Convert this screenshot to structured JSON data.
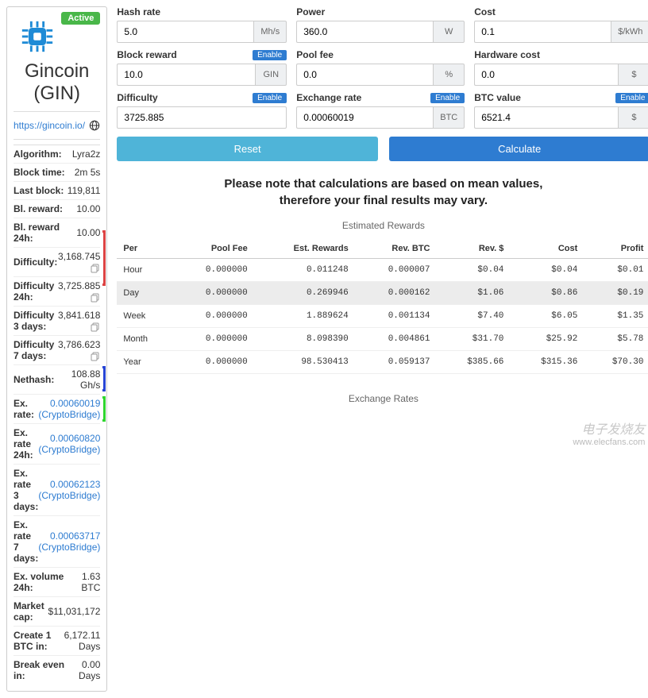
{
  "coin": {
    "status": "Active",
    "name": "Gincoin (GIN)",
    "url": "https://gincoin.io/"
  },
  "stats": {
    "algorithm": {
      "label": "Algorithm:",
      "value": "Lyra2z"
    },
    "block_time": {
      "label": "Block time:",
      "value": "2m 5s"
    },
    "last_block": {
      "label": "Last block:",
      "value": "119,811"
    },
    "bl_reward": {
      "label": "Bl. reward:",
      "value": "10.00"
    },
    "bl_reward_24h": {
      "label": "Bl. reward 24h:",
      "value": "10.00"
    },
    "difficulty": {
      "label": "Difficulty:",
      "value": "3,168.745"
    },
    "difficulty_24h": {
      "label": "Difficulty 24h:",
      "value": "3,725.885"
    },
    "difficulty_3d": {
      "label": "Difficulty 3 days:",
      "value": "3,841.618"
    },
    "difficulty_7d": {
      "label": "Difficulty 7 days:",
      "value": "3,786.623"
    },
    "nethash": {
      "label": "Nethash:",
      "value": "108.88 Gh/s"
    },
    "ex_rate": {
      "label": "Ex. rate:",
      "value": "0.00060019 (CryptoBridge)"
    },
    "ex_rate_24h": {
      "label": "Ex. rate 24h:",
      "value": "0.00060820 (CryptoBridge)"
    },
    "ex_rate_3d": {
      "label": "Ex. rate 3 days:",
      "value": "0.00062123 (CryptoBridge)"
    },
    "ex_rate_7d": {
      "label": "Ex. rate 7 days:",
      "value": "0.00063717 (CryptoBridge)"
    },
    "ex_vol_24h": {
      "label": "Ex. volume 24h:",
      "value": "1.63 BTC"
    },
    "market_cap": {
      "label": "Market cap:",
      "value": "$11,031,172"
    },
    "create_btc": {
      "label": "Create 1 BTC in:",
      "value": "6,172.11 Days"
    },
    "break_even": {
      "label": "Break even in:",
      "value": "0.00 Days"
    }
  },
  "form": {
    "hash_rate": {
      "label": "Hash rate",
      "value": "5.0",
      "unit": "Mh/s"
    },
    "power": {
      "label": "Power",
      "value": "360.0",
      "unit": "W"
    },
    "cost": {
      "label": "Cost",
      "value": "0.1",
      "unit": "$/kWh"
    },
    "block_reward": {
      "label": "Block reward",
      "value": "10.0",
      "unit": "GIN",
      "enable": "Enable"
    },
    "pool_fee": {
      "label": "Pool fee",
      "value": "0.0",
      "unit": "%"
    },
    "hardware_cost": {
      "label": "Hardware cost",
      "value": "0.0",
      "unit": "$"
    },
    "difficulty": {
      "label": "Difficulty",
      "value": "3725.885",
      "unit": "",
      "enable": "Enable"
    },
    "exchange_rate": {
      "label": "Exchange rate",
      "value": "0.00060019",
      "unit": "BTC",
      "enable": "Enable"
    },
    "btc_value": {
      "label": "BTC value",
      "value": "6521.4",
      "unit": "$",
      "enable": "Enable"
    }
  },
  "buttons": {
    "reset": "Reset",
    "calculate": "Calculate"
  },
  "note": "Please note that calculations are based on mean values,\ntherefore your final results may vary.",
  "rewards_title": "Estimated Rewards",
  "rewards_headers": [
    "Per",
    "Pool Fee",
    "Est. Rewards",
    "Rev. BTC",
    "Rev. $",
    "Cost",
    "Profit"
  ],
  "rewards": [
    {
      "per": "Hour",
      "pool_fee": "0.000000",
      "est": "0.011248",
      "rev_btc": "0.000007",
      "rev_usd": "$0.04",
      "cost": "$0.04",
      "profit": "$0.01"
    },
    {
      "per": "Day",
      "pool_fee": "0.000000",
      "est": "0.269946",
      "rev_btc": "0.000162",
      "rev_usd": "$1.06",
      "cost": "$0.86",
      "profit": "$0.19",
      "highlight": true
    },
    {
      "per": "Week",
      "pool_fee": "0.000000",
      "est": "1.889624",
      "rev_btc": "0.001134",
      "rev_usd": "$7.40",
      "cost": "$6.05",
      "profit": "$1.35"
    },
    {
      "per": "Month",
      "pool_fee": "0.000000",
      "est": "8.098390",
      "rev_btc": "0.004861",
      "rev_usd": "$31.70",
      "cost": "$25.92",
      "profit": "$5.78"
    },
    {
      "per": "Year",
      "pool_fee": "0.000000",
      "est": "98.530413",
      "rev_btc": "0.059137",
      "rev_usd": "$385.66",
      "cost": "$315.36",
      "profit": "$70.30"
    }
  ],
  "exchange_rates_title": "Exchange Rates",
  "watermark": {
    "sign": "电子发烧友",
    "url": "www.elecfans.com"
  },
  "chart_data": {
    "type": "table",
    "title": "Estimated Rewards",
    "columns": [
      "Per",
      "Pool Fee",
      "Est. Rewards",
      "Rev. BTC",
      "Rev. $",
      "Cost",
      "Profit"
    ],
    "rows": [
      [
        "Hour",
        0.0,
        0.011248,
        7e-06,
        0.04,
        0.04,
        0.01
      ],
      [
        "Day",
        0.0,
        0.269946,
        0.000162,
        1.06,
        0.86,
        0.19
      ],
      [
        "Week",
        0.0,
        1.889624,
        0.001134,
        7.4,
        6.05,
        1.35
      ],
      [
        "Month",
        0.0,
        8.09839,
        0.004861,
        31.7,
        25.92,
        5.78
      ],
      [
        "Year",
        0.0,
        98.530413,
        0.059137,
        385.66,
        315.36,
        70.3
      ]
    ]
  }
}
